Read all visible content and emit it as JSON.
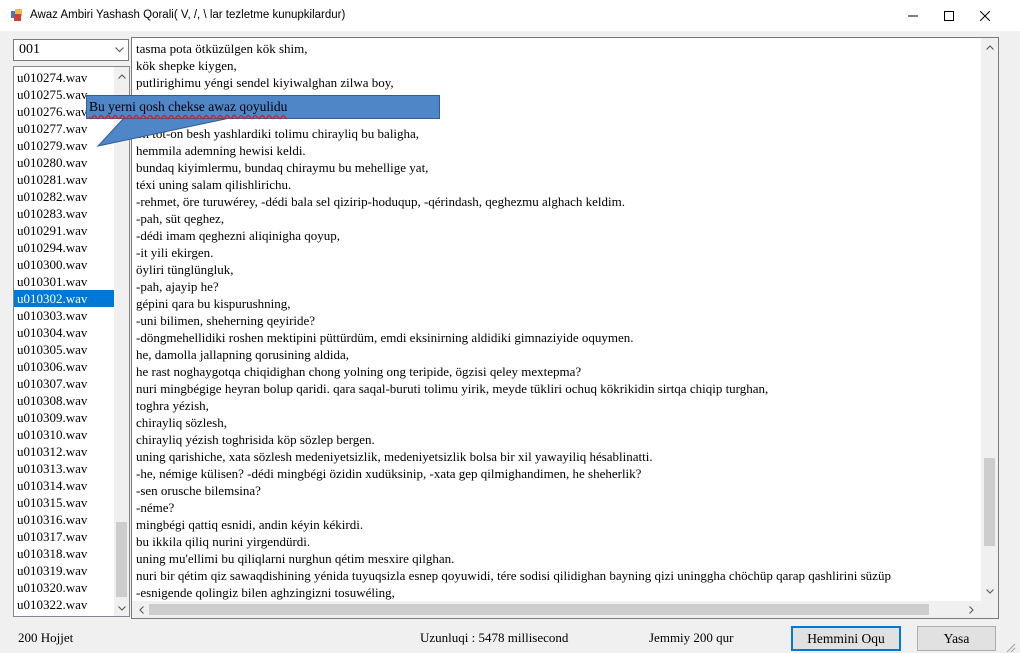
{
  "window": {
    "title": "Awaz Ambiri Yashash Qorali( V, /, \\ lar tezletme kunupkilardur)",
    "icon": "app-icon"
  },
  "combo": {
    "selected": "001"
  },
  "file_list": {
    "selected_index": 13,
    "items": [
      "u010274.wav",
      "u010275.wav",
      "u010276.wav",
      "u010277.wav",
      "u010279.wav",
      "u010280.wav",
      "u010281.wav",
      "u010282.wav",
      "u010283.wav",
      "u010291.wav",
      "u010294.wav",
      "u010300.wav",
      "u010301.wav",
      "u010302.wav",
      "u010303.wav",
      "u010304.wav",
      "u010305.wav",
      "u010306.wav",
      "u010307.wav",
      "u010308.wav",
      "u010309.wav",
      "u010310.wav",
      "u010312.wav",
      "u010313.wav",
      "u010314.wav",
      "u010315.wav",
      "u010316.wav",
      "u010317.wav",
      "u010318.wav",
      "u010319.wav",
      "u010320.wav",
      "u010322.wav"
    ]
  },
  "tooltip": {
    "text": "Bu yerni qosh chekse awaz qoyulidu"
  },
  "text_lines": [
    "tasma pota ötküzülgen kök shim,",
    "kök shepke kiygen,",
    "putlirighimu yéngi sendel kiyiwalghan zilwa boy,",
    "",
    "",
    "on töt-on besh yashlardiki tolimu chirayliq bu baligha,",
    "hemmila ademning hewisi keldi.",
    "bundaq kiyimlermu, bundaq chiraymu bu mehellige yat,",
    "téxi uning salam qilishlirichu.",
    "-rehmet, öre turuwérey, -dédi bala sel qizirip-hoduqup, -qérindash, qeghezmu alghach keldim.",
    "-pah, süt qeghez,",
    "-dédi imam qeghezni aliqinigha qoyup,",
    "-it yili ekirgen.",
    "öyliri tünglüngluk,",
    "-pah, ajayip he?",
    "gépini qara bu kispurushning,",
    "-uni bilimen, sheherning qeyiride?",
    "-döngmehellidiki roshen mektipini püttürdüm, emdi eksinirning aldidiki gimnaziyide oquymen.",
    "he, damolla jallapning qorusining aldida,",
    "he rast noghaygotqa chiqidighan chong yolning ong teripide, ögzisi qeley mextepma?",
    "nuri mingbégige heyran bolup qaridi. qara saqal-buruti tolimu yirik, meyde tükliri ochuq kökrikidin sirtqa chiqip turghan,",
    "toghra yézish,",
    "chirayliq sözlesh,",
    "chirayliq yézish toghrisida köp sözlep bergen.",
    "uning qarishiche, xata sözlesh medeniyetsizlik, medeniyetsizlik bolsa bir xil yawayiliq hésablinatti.",
    "-he, némige külisen? -dédi mingbégi özidin xudüksinip, -xata gep qilmighandimen, he sheherlik?",
    "-sen orusche bilemsina?",
    "-néme?",
    "mingbégi qattiq esnidi, andin kéyin kékirdi.",
    "bu ikkila qiliq nurini yirgendürdi.",
    "uning mu'ellimi bu qiliqlarni nurghun qétim mesxire qilghan.",
    "nuri bir qétim qiz sawaqdishining yénida tuyuqsizla esnep qoyuwidi, tére sodisi qilidighan bayning qizi uninggha chöchüp qarap qashlirini süzüp",
    "-esnigende qolingiz bilen aghzingizni tosuwéling,"
  ],
  "status": {
    "count": "200 Hojjet",
    "duration": "Uzunluqi : 5478 millisecond",
    "total": "Jemmiy 200 qur"
  },
  "buttons": {
    "oqu": "Hemmini Oqu",
    "yasa": "Yasa"
  },
  "colors": {
    "selection": "#0078d7",
    "tooltip": "#4f86c8",
    "background": "#f0f0f0"
  }
}
